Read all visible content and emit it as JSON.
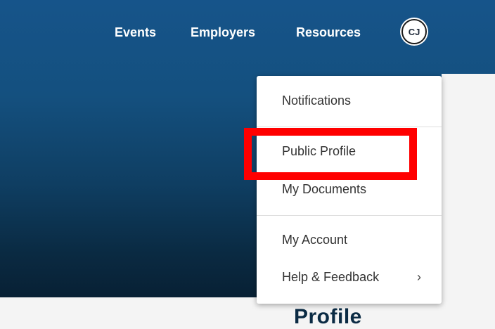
{
  "nav": {
    "events_label": "Events",
    "employers_label": "Employers",
    "resources_label": "Resources",
    "avatar_initials": "CJ"
  },
  "menu": {
    "items": [
      {
        "label": "Notifications"
      },
      {
        "label": "Public Profile"
      },
      {
        "label": "My Documents"
      },
      {
        "label": "My Account"
      },
      {
        "label": "Help & Feedback"
      }
    ],
    "submenu_chevron": "›"
  },
  "page": {
    "heading_partial": "Profile"
  },
  "colors": {
    "header_blue": "#16548a",
    "highlight_red": "#ff0000"
  }
}
